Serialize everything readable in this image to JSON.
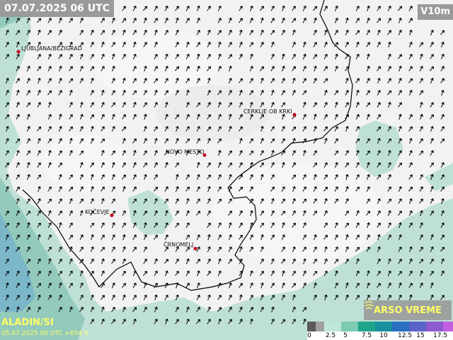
{
  "header": {
    "timestamp": "07.07.2025 06 UTC",
    "variable": "V10m"
  },
  "footer": {
    "model": "ALADIN/SI",
    "run_info": "05.07.2025 00 UTC +054 h",
    "logo_text": "ARSO VREME"
  },
  "cities": [
    {
      "name": "LJUBLJANA/BEŽIGRAD"
    },
    {
      "name": "CERKLJE OB KRKI"
    },
    {
      "name": "NOVO MESTO"
    },
    {
      "name": "KOČEVJE"
    },
    {
      "name": "ČRNOMELJ"
    }
  ],
  "legend": {
    "labels": [
      "0",
      "2.5",
      "5",
      "7.5",
      "10",
      "12.5",
      "15",
      "17.5"
    ],
    "colors": [
      "#5a5a5a",
      "#a0a0a0",
      "#bfe6da",
      "#7ccbb3",
      "#1ea58c",
      "#1a8fa0",
      "#2a6fc0",
      "#5a63c8",
      "#8e5ad0",
      "#c060e0"
    ]
  },
  "colors": {
    "land": "#f2f2f2",
    "wind_shade": "#bfe0d6",
    "wind_shade_strong": "#94cabb",
    "city_dot": "#c0001a",
    "border": "#000000"
  }
}
